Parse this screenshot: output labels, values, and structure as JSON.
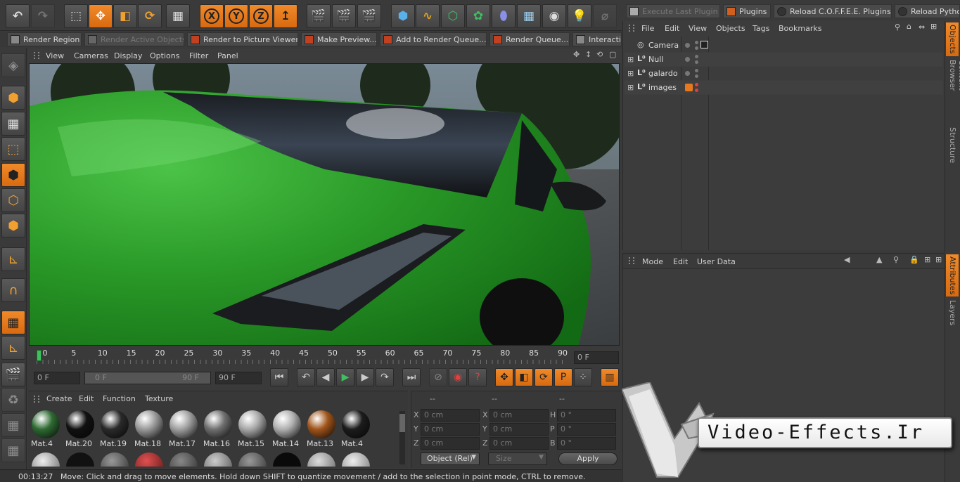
{
  "top_toolbar": {
    "axis_labels": [
      "X",
      "Y",
      "Z"
    ]
  },
  "render_bar": {
    "items": [
      {
        "label": "Render Region",
        "dim": false
      },
      {
        "label": "Render Active Objects",
        "dim": true
      },
      {
        "label": "Render to Picture Viewer",
        "dim": false
      },
      {
        "label": "Make Preview...",
        "dim": false
      },
      {
        "label": "Add to Render Queue...",
        "dim": false
      },
      {
        "label": "Render Queue...",
        "dim": false
      },
      {
        "label": "Interactive",
        "dim": false
      }
    ]
  },
  "plugins_bar": {
    "items": [
      {
        "label": "Execute Last Plugin",
        "dim": true
      },
      {
        "label": "Plugins",
        "dim": false
      },
      {
        "label": "Reload C.O.F.F.E.E. Plugins",
        "dim": false
      },
      {
        "label": "Reload Python Plugins",
        "dim": false
      }
    ]
  },
  "viewport": {
    "menu": [
      "View",
      "Cameras",
      "Display",
      "Options",
      "Filter",
      "Panel"
    ]
  },
  "objects_panel": {
    "menu": [
      "File",
      "Edit",
      "View",
      "Objects",
      "Tags",
      "Bookmarks"
    ],
    "rows": [
      {
        "name": "Camera",
        "icon": "camera-icon"
      },
      {
        "name": "Null",
        "icon": "null-icon"
      },
      {
        "name": "galardo",
        "icon": "null-icon"
      },
      {
        "name": "images",
        "icon": "null-icon"
      }
    ],
    "side_tabs": [
      "Objects",
      "Content Browser",
      "Structure"
    ]
  },
  "attributes_panel": {
    "menu": [
      "Mode",
      "Edit",
      "User Data"
    ],
    "side_tabs": [
      "Attributes",
      "Layers"
    ]
  },
  "timeline": {
    "ticks": [
      "0",
      "5",
      "10",
      "15",
      "20",
      "25",
      "30",
      "35",
      "40",
      "45",
      "50",
      "55",
      "60",
      "65",
      "70",
      "75",
      "80",
      "85",
      "90"
    ],
    "current_frame": "0 F",
    "playhead_fraction": 0,
    "start_field": "0 F",
    "range_start": "0 F",
    "range_end": "90 F",
    "end_field": "90 F"
  },
  "material_panel": {
    "menu": [
      "Create",
      "Edit",
      "Function",
      "Texture"
    ],
    "materials": [
      {
        "name": "Mat.4",
        "color": "#2e6a32"
      },
      {
        "name": "Mat.20",
        "color": "#111111"
      },
      {
        "name": "Mat.19",
        "color": "#2a2a2a"
      },
      {
        "name": "Mat.18",
        "color": "#9a9a9a"
      },
      {
        "name": "Mat.17",
        "color": "#a0a0a0"
      },
      {
        "name": "Mat.16",
        "color": "#707070"
      },
      {
        "name": "Mat.15",
        "color": "#a8a8a8"
      },
      {
        "name": "Mat.14",
        "color": "#b0b0b0"
      },
      {
        "name": "Mat.13",
        "color": "#a0541a"
      },
      {
        "name": "Mat.4",
        "color": "#1c1c1c"
      }
    ]
  },
  "coords_panel": {
    "headers": [
      "--",
      "--",
      "--"
    ],
    "rows": [
      {
        "a_label": "X",
        "a_value": "0 cm",
        "b_label": "X",
        "b_value": "0 cm",
        "c_label": "H",
        "c_value": "0 °"
      },
      {
        "a_label": "Y",
        "a_value": "0 cm",
        "b_label": "Y",
        "b_value": "0 cm",
        "c_label": "P",
        "c_value": "0 °"
      },
      {
        "a_label": "Z",
        "a_value": "0 cm",
        "b_label": "Z",
        "b_value": "0 cm",
        "c_label": "B",
        "c_value": "0 °"
      }
    ],
    "mode_select": "Object (Rel)",
    "size_select": "Size",
    "apply_label": "Apply"
  },
  "status_bar": {
    "time": "00:13:27",
    "message": "Move: Click and drag to move elements. Hold down SHIFT to quantize movement / add to the selection in point mode, CTRL to remove."
  },
  "watermark": {
    "text": "Video-Effects.Ir"
  },
  "colors": {
    "accent": "#e8781e",
    "car_green": "#2f9a2a",
    "panel_bg": "#3c3c3c"
  }
}
